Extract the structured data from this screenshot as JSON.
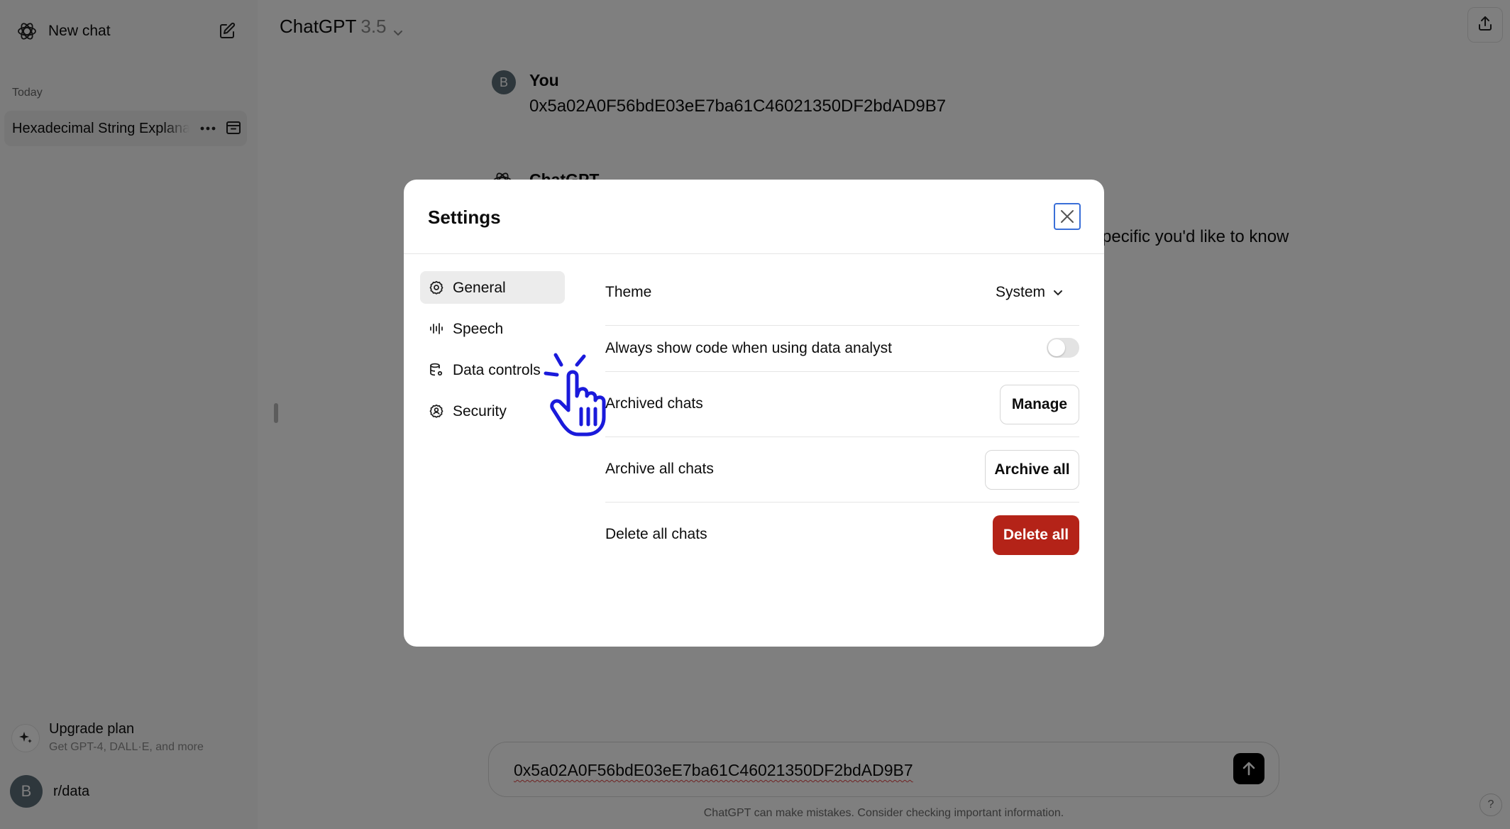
{
  "sidebar": {
    "new_chat_label": "New chat",
    "section_today": "Today",
    "chats": [
      {
        "title": "Hexadecimal String Explanation"
      }
    ],
    "upgrade": {
      "title": "Upgrade plan",
      "subtitle": "Get GPT-4, DALL·E, and more"
    },
    "user": {
      "initial": "B",
      "name": "r/data"
    }
  },
  "header": {
    "model_name": "ChatGPT",
    "model_version": "3.5"
  },
  "conversation": {
    "user_initial": "B",
    "user_author": "You",
    "user_message": "0x5a02A0F56bdE03eE7ba61C46021350DF2bdAD9B7",
    "assistant_author": "ChatGPT",
    "assistant_visible_fragment": "pecific you'd like to know"
  },
  "composer": {
    "value": "0x5a02A0F56bdE03eE7ba61C46021350DF2bdAD9B7",
    "disclaimer": "ChatGPT can make mistakes. Consider checking important information.",
    "help": "?"
  },
  "settings_modal": {
    "title": "Settings",
    "nav": [
      {
        "label": "General",
        "icon": "gear-icon",
        "active": true
      },
      {
        "label": "Speech",
        "icon": "waveform-icon",
        "active": false
      },
      {
        "label": "Data controls",
        "icon": "database-gear-icon",
        "active": false
      },
      {
        "label": "Security",
        "icon": "shield-user-icon",
        "active": false
      }
    ],
    "theme": {
      "label": "Theme",
      "value": "System"
    },
    "code_toggle": {
      "label": "Always show code when using data analyst",
      "on": false
    },
    "archived_chats": {
      "label": "Archived chats",
      "button": "Manage"
    },
    "archive_all": {
      "label": "Archive all chats",
      "button": "Archive all"
    },
    "delete_all": {
      "label": "Delete all chats",
      "button": "Delete all"
    }
  },
  "colors": {
    "danger": "#b42318",
    "focus_ring": "#3a6fd8",
    "cursor_annotation": "#1a1adb",
    "overlay": "rgba(0,0,0,0.5)"
  }
}
